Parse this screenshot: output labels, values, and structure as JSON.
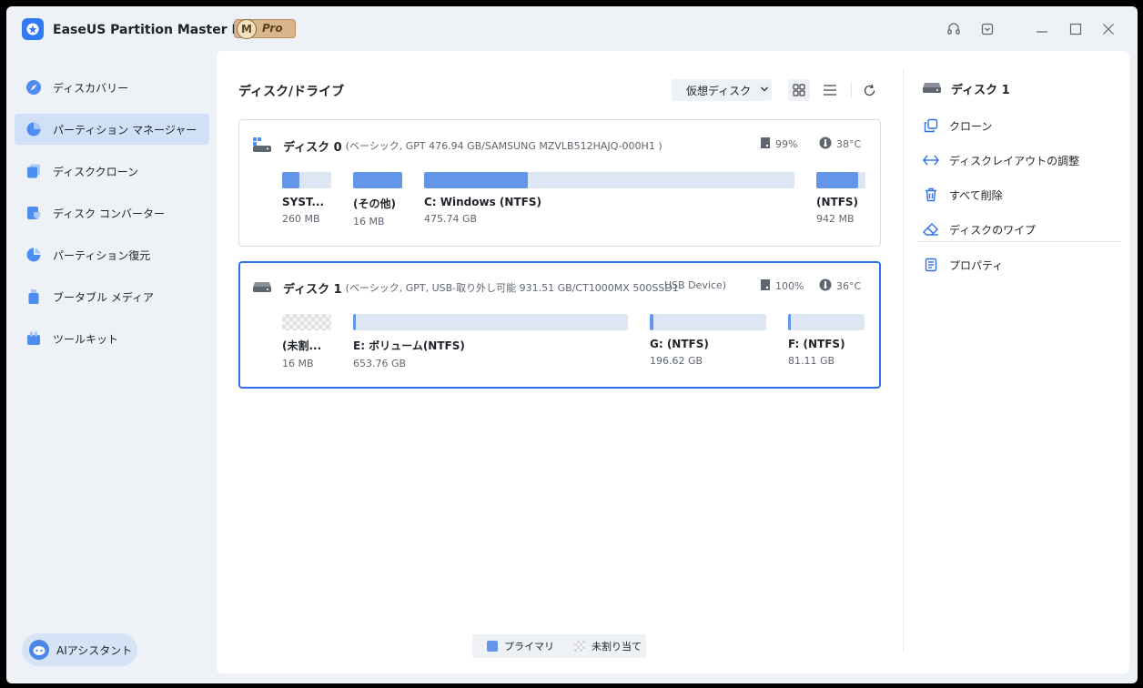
{
  "app": {
    "title": "EaseUS Partition Master Pro版",
    "badge_m": "M",
    "badge_label": "Pro"
  },
  "sidebar": {
    "items": [
      {
        "label": "ディスカバリー",
        "icon": "discovery-icon"
      },
      {
        "label": "パーティション マネージャー",
        "icon": "partition-manager-icon",
        "active": true
      },
      {
        "label": "ディスククローン",
        "icon": "disk-clone-icon"
      },
      {
        "label": "ディスク コンバーター",
        "icon": "disk-converter-icon"
      },
      {
        "label": "パーティション復元",
        "icon": "partition-recovery-icon"
      },
      {
        "label": "ブータブル メディア",
        "icon": "bootable-media-icon"
      },
      {
        "label": "ツールキット",
        "icon": "toolkit-icon"
      }
    ],
    "ai_label": "AIアシスタント"
  },
  "main": {
    "title": "ディスク/ドライブ",
    "vdisk_label": "仮想ディスク"
  },
  "disks": [
    {
      "name": "ディスク 0",
      "info": "(ベーシック, GPT 476.94 GB/SAMSUNG MZVLB512HAJQ-000H1 )",
      "health": "99%",
      "temp": "38°C",
      "partitions": [
        {
          "label": "SYST...",
          "size": "260 MB",
          "used": 0.35
        },
        {
          "label": "(その他)",
          "size": "16 MB",
          "used": 1.0
        },
        {
          "label": "C: Windows (NTFS)",
          "size": "475.74 GB",
          "used": 0.28
        },
        {
          "label": "(NTFS)",
          "size": "942 MB",
          "used": 0.85
        }
      ]
    },
    {
      "name": "ディスク 1",
      "info": "(ベーシック, GPT, USB-取り外し可能 931.51 GB/CT1000MX 500SSD1",
      "device": "USB Device)",
      "health": "100%",
      "temp": "36°C",
      "partitions": [
        {
          "label": "(未割...",
          "size": "16 MB",
          "unallocated": true
        },
        {
          "label": "E: ボリューム(NTFS)",
          "size": "653.76 GB",
          "used": 0.01
        },
        {
          "label": "G: (NTFS)",
          "size": "196.62 GB",
          "used": 0.03
        },
        {
          "label": "F: (NTFS)",
          "size": "81.11 GB",
          "used": 0.03
        }
      ]
    }
  ],
  "legend": {
    "primary": "プライマリ",
    "unallocated": "未割り当て"
  },
  "right_panel": {
    "title": "ディスク 1",
    "actions": [
      {
        "label": "クローン",
        "icon": "clone-icon"
      },
      {
        "label": "ディスクレイアウトの調整",
        "icon": "adjust-layout-icon"
      },
      {
        "label": "すべて削除",
        "icon": "trash-icon"
      },
      {
        "label": "ディスクのワイプ",
        "icon": "eraser-icon"
      },
      {
        "label": "プロパティ",
        "icon": "properties-icon"
      }
    ]
  },
  "colors": {
    "accent": "#2f6fe8",
    "primary_partition": "#6395e8",
    "active_nav": "#cfe0f7"
  }
}
